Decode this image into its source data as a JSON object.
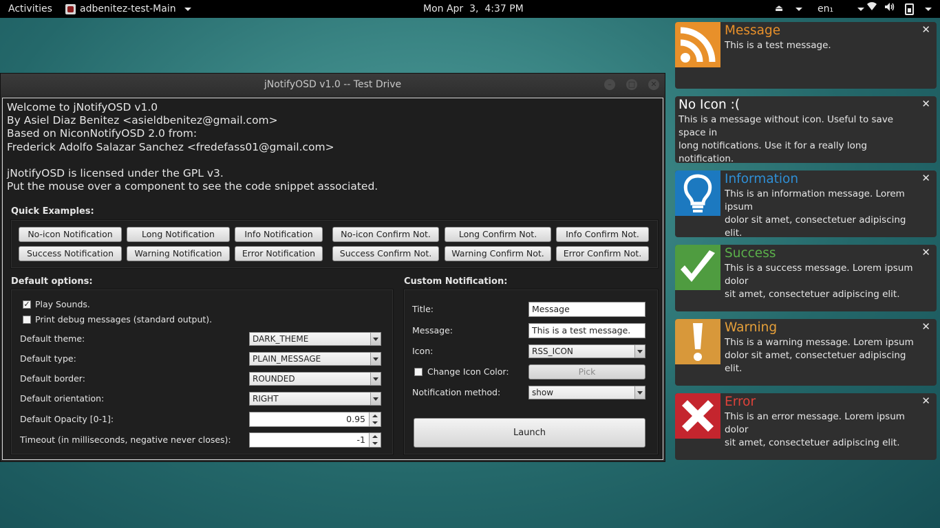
{
  "topbar": {
    "activities": "Activities",
    "app_name": "adbenitez-test-Main",
    "clock": "Mon Apr  3,  4:37 PM",
    "language": "en₁"
  },
  "window": {
    "title": "jNotifyOSD v1.0 -- Test Drive",
    "intro_lines": [
      "Welcome to jNotifyOSD v1.0",
      "By Asiel Diaz Benitez <asieldbenitez@gmail.com>",
      "Based on NiconNotifyOSD 2.0 from:",
      "Frederick Adolfo Salazar Sanchez <fredefass01@gmail.com>",
      "",
      "jNotifyOSD is licensed under the GPL v3.",
      "Put the mouse over a component to see the code snippet associated."
    ],
    "quick_examples": {
      "label": "Quick Examples:",
      "row1": [
        "No-icon Notification",
        "Long Notification",
        "Info Notification",
        "No-icon Confirm Not.",
        "Long Confirm Not.",
        "Info Confirm Not."
      ],
      "row2": [
        "Success Notification",
        "Warning Notification",
        "Error Notification",
        "Success Confirm Not.",
        "Warning Confirm Not.",
        "Error Confirm Not."
      ]
    },
    "default_options": {
      "label": "Default options:",
      "play_sounds": "Play Sounds.",
      "play_sounds_checked": true,
      "debug": "Print debug messages (standard output).",
      "debug_checked": false,
      "theme_label": "Default theme:",
      "theme_value": "DARK_THEME",
      "type_label": "Default type:",
      "type_value": "PLAIN_MESSAGE",
      "border_label": "Default border:",
      "border_value": "ROUNDED",
      "orientation_label": "Default orientation:",
      "orientation_value": "RIGHT",
      "opacity_label": "Default Opacity [0-1]:",
      "opacity_value": "0.95",
      "timeout_label": "Timeout (in milliseconds, negative never closes):",
      "timeout_value": "-1"
    },
    "custom": {
      "label": "Custom Notification:",
      "title_label": "Title:",
      "title_value": "Message",
      "message_label": "Message:",
      "message_value": "This is a test message.",
      "icon_label": "Icon:",
      "icon_value": "RSS_ICON",
      "change_color_label": "Change Icon Color:",
      "change_color_checked": false,
      "pick": "Pick",
      "method_label": "Notification method:",
      "method_value": "show",
      "launch": "Launch"
    }
  },
  "notifications": [
    {
      "icon": "rss-icon",
      "color": "#e8902a",
      "title": "Message",
      "lines": [
        "This is a test message."
      ]
    },
    {
      "icon": "",
      "color": "#ffffff",
      "title": "No Icon :(",
      "lines": [
        "This is a message without icon. Useful to save space in",
        "long notifications. Use it for a really long notification."
      ]
    },
    {
      "icon": "lightbulb-icon",
      "color": "#2f8fd6",
      "title": "Information",
      "lines": [
        "This is an information message. Lorem ipsum",
        "dolor sit amet, consectetuer adipiscing elit."
      ]
    },
    {
      "icon": "checkmark-icon",
      "color": "#5bb04a",
      "title": "Success",
      "lines": [
        "This is a success message. Lorem ipsum dolor",
        "sit amet, consectetuer adipiscing elit."
      ]
    },
    {
      "icon": "exclamation-icon",
      "color": "#e6a03a",
      "title": "Warning",
      "lines": [
        "This is a warning message. Lorem ipsum",
        "dolor sit amet, consectetuer adipiscing elit."
      ]
    },
    {
      "icon": "x-icon",
      "color": "#e0423a",
      "title": "Error",
      "lines": [
        "This is an error message. Lorem ipsum dolor",
        "sit amet, consectetuer adipiscing elit."
      ]
    }
  ]
}
